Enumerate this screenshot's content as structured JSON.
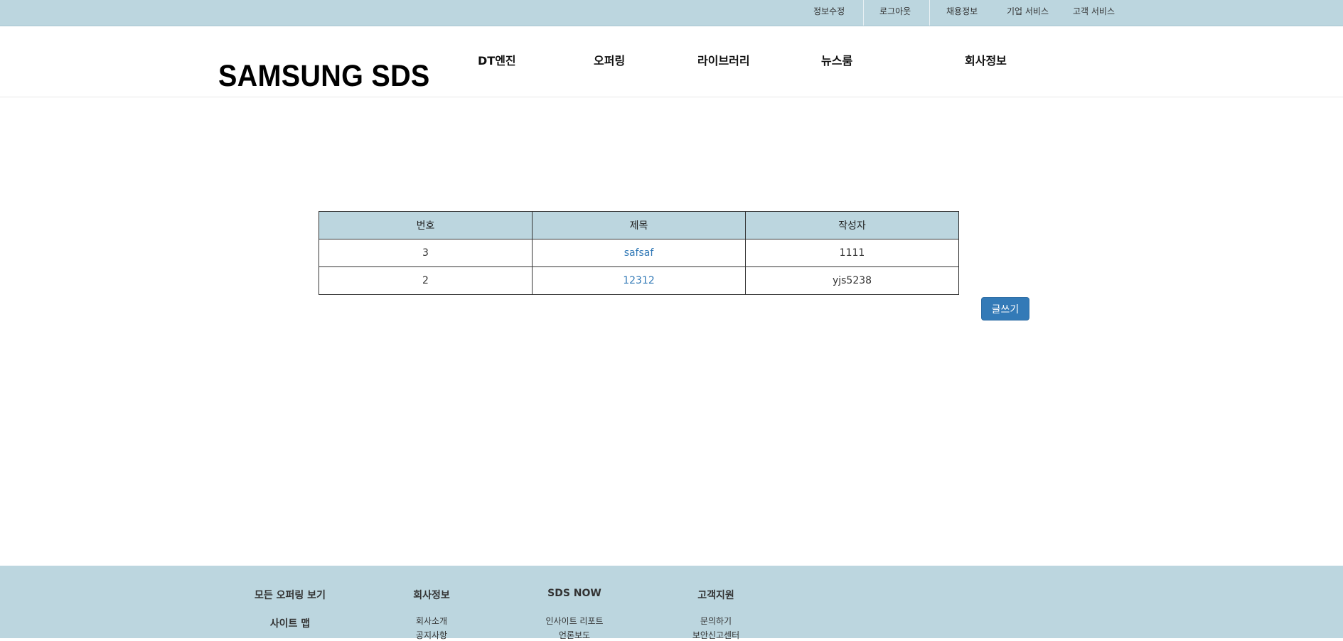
{
  "topbar": {
    "links": [
      "정보수정",
      "로그아웃",
      "채용정보",
      "기업 서비스",
      "고객 서비스"
    ]
  },
  "header": {
    "logo": "SAMSUNG SDS",
    "nav": [
      "DT엔진",
      "오퍼링",
      "라이브러리",
      "뉴스룸",
      "회사정보"
    ]
  },
  "board": {
    "columns": [
      "번호",
      "제목",
      "작성자"
    ],
    "rows": [
      {
        "no": "3",
        "title": "safsaf",
        "author": "1111"
      },
      {
        "no": "2",
        "title": "12312",
        "author": "yjs5238"
      }
    ],
    "write_button": "글쓰기"
  },
  "footer": {
    "col1": {
      "heading": "모든 오퍼링 보기",
      "heading2": "사이트 맵"
    },
    "col2": {
      "heading": "회사정보",
      "links": [
        "회사소개",
        "공지사항"
      ]
    },
    "col3": {
      "heading": "SDS NOW",
      "links": [
        "인사이트 리포트",
        "언론보도"
      ]
    },
    "col4": {
      "heading": "고객지원",
      "links": [
        "문의하기",
        "보안신고센터"
      ]
    }
  },
  "colors": {
    "accent_bar": "#bcd6df",
    "button": "#337ab7",
    "link": "#337ab7"
  }
}
